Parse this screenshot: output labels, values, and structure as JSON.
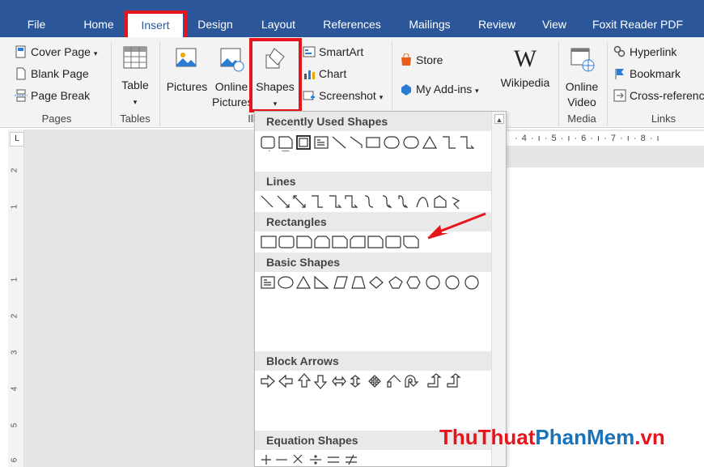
{
  "tabs": [
    "File",
    "Home",
    "Insert",
    "Design",
    "Layout",
    "References",
    "Mailings",
    "Review",
    "View",
    "Foxit Reader PDF"
  ],
  "active_tab": "Insert",
  "ribbon": {
    "pages": {
      "cover": "Cover Page",
      "blank": "Blank Page",
      "break": "Page Break",
      "label": "Pages"
    },
    "tables": {
      "table": "Table",
      "label": "Tables"
    },
    "illustrations": {
      "pictures": "Pictures",
      "online_pictures_1": "Online",
      "online_pictures_2": "Pictures",
      "shapes": "Shapes",
      "smartart": "SmartArt",
      "chart": "Chart",
      "screenshot": "Screenshot",
      "label": "Ill"
    },
    "addins": {
      "store": "Store",
      "my_addins": "My Add-ins",
      "wikipedia": "Wikipedia"
    },
    "media": {
      "online_video_1": "Online",
      "online_video_2": "Video",
      "label": "Media"
    },
    "links": {
      "hyperlink": "Hyperlink",
      "bookmark": "Bookmark",
      "crossref": "Cross-referenc",
      "label": "Links"
    }
  },
  "dropdown": {
    "sections": [
      "Recently Used Shapes",
      "Lines",
      "Rectangles",
      "Basic Shapes",
      "Block Arrows",
      "Equation Shapes"
    ]
  },
  "ruler": {
    "h": "· 4 · ı · 5 · ı · 6 · ı · 7 · ı · 8 · ı",
    "v_numbers": [
      "2",
      "1",
      "1",
      "2",
      "3",
      "4",
      "5",
      "6"
    ]
  },
  "watermark": {
    "part1": "ThuThuat",
    "part2": "PhanMem",
    "part3": ".vn"
  },
  "colors": {
    "ribbon_blue": "#2b579a",
    "highlight_red": "#e8141b",
    "watermark_blue": "#1a73b8"
  }
}
